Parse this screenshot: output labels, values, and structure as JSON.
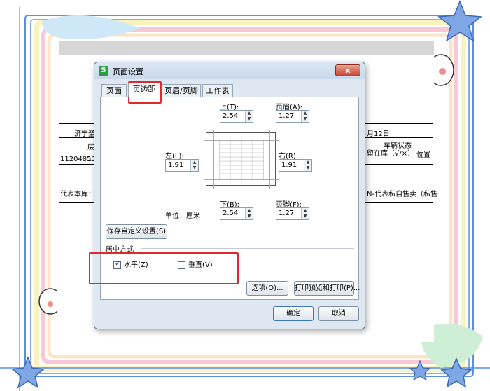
{
  "dialog": {
    "title": "页面设置",
    "app_icon_letter": "S",
    "close_label": "x"
  },
  "tabs": [
    {
      "label": "页面",
      "active": false
    },
    {
      "label": "页边距",
      "active": true
    },
    {
      "label": "页眉/页脚",
      "active": false
    },
    {
      "label": "工作表",
      "active": false
    }
  ],
  "margins": {
    "top": {
      "label": "上(T):",
      "value": "2.54"
    },
    "header": {
      "label": "页眉(A):",
      "value": "1.27"
    },
    "left": {
      "label": "左(L):",
      "value": "1.91"
    },
    "right": {
      "label": "右(R):",
      "value": "1.91"
    },
    "bottom": {
      "label": "下(B):",
      "value": "2.54"
    },
    "footer": {
      "label": "页脚(F):",
      "value": "1.27"
    },
    "unit_label": "单位：厘米"
  },
  "buttons": {
    "save_custom": "保存自定义设置(S)",
    "options": "选项(O)...",
    "print_preview": "打印预览和打印(P)...",
    "ok": "确定",
    "cancel": "取消"
  },
  "centering": {
    "group_label": "居中方式",
    "horizontal": {
      "label": "水平(Z)",
      "checked": true
    },
    "vertical": {
      "label": "垂直(V)",
      "checked": false
    }
  },
  "background_sheet": {
    "left_texts": [
      "济宁圣",
      "层",
      "1120485",
      "12"
    ],
    "right_texts": [
      "月12日",
      "车辆状态",
      "留在库（√/×）",
      "位置"
    ],
    "left_bottom_text": "代表本库：O",
    "right_bottom_text": "N-代表私自售卖（私售"
  },
  "colors": {
    "highlight_red": "#e0282f",
    "frame_blue": "#5b8fe0",
    "frame_pink": "#f3b6c8",
    "frame_yellow": "#f8efb0"
  }
}
